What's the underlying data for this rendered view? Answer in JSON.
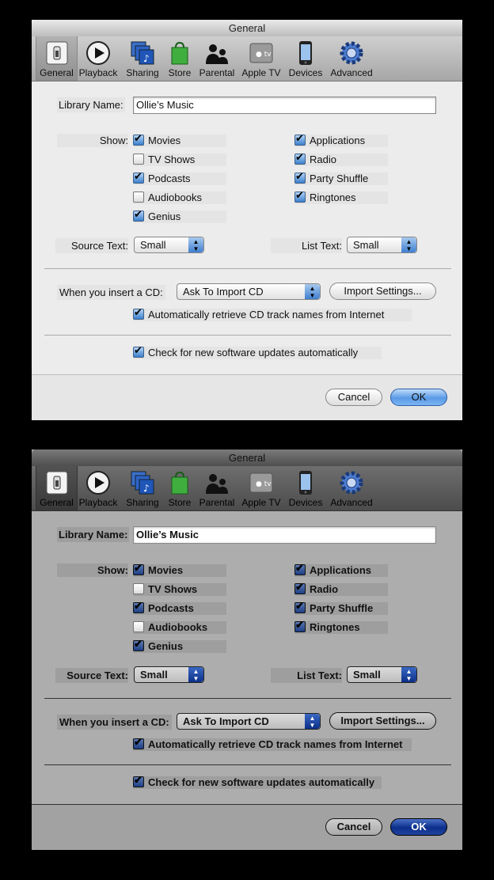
{
  "window_title": "General",
  "toolbar": {
    "items": [
      {
        "label": "General",
        "icon": "general-switch-icon"
      },
      {
        "label": "Playback",
        "icon": "play-icon"
      },
      {
        "label": "Sharing",
        "icon": "sharing-icon"
      },
      {
        "label": "Store",
        "icon": "store-bag-icon"
      },
      {
        "label": "Parental",
        "icon": "parental-icon"
      },
      {
        "label": "Apple TV",
        "icon": "apple-tv-icon"
      },
      {
        "label": "Devices",
        "icon": "iphone-icon"
      },
      {
        "label": "Advanced",
        "icon": "gear-icon"
      }
    ],
    "selected": "General"
  },
  "library": {
    "label": "Library Name:",
    "value": "Ollie’s Music"
  },
  "show": {
    "label": "Show:",
    "left": [
      {
        "label": "Movies",
        "checked": true
      },
      {
        "label": "TV Shows",
        "checked": false
      },
      {
        "label": "Podcasts",
        "checked": true
      },
      {
        "label": "Audiobooks",
        "checked": false
      },
      {
        "label": "Genius",
        "checked": true
      }
    ],
    "right": [
      {
        "label": "Applications",
        "checked": true
      },
      {
        "label": "Radio",
        "checked": true
      },
      {
        "label": "Party Shuffle",
        "checked": true
      },
      {
        "label": "Ringtones",
        "checked": true
      }
    ]
  },
  "source_text": {
    "label": "Source Text:",
    "value": "Small"
  },
  "list_text": {
    "label": "List Text:",
    "value": "Small"
  },
  "cd": {
    "label": "When you insert a CD:",
    "value": "Ask To Import CD",
    "import_button": "Import Settings...",
    "auto_retrieve": {
      "label": "Automatically retrieve CD track names from Internet",
      "checked": true
    }
  },
  "updates": {
    "label": "Check for new software updates automatically",
    "checked": true
  },
  "buttons": {
    "cancel": "Cancel",
    "ok": "OK"
  },
  "colors": {
    "accent_blue": "#3f7fd0",
    "dark_accent_blue": "#0b2f8a",
    "window_bg": "#ececec",
    "dark_window_bg": "#adadad"
  }
}
